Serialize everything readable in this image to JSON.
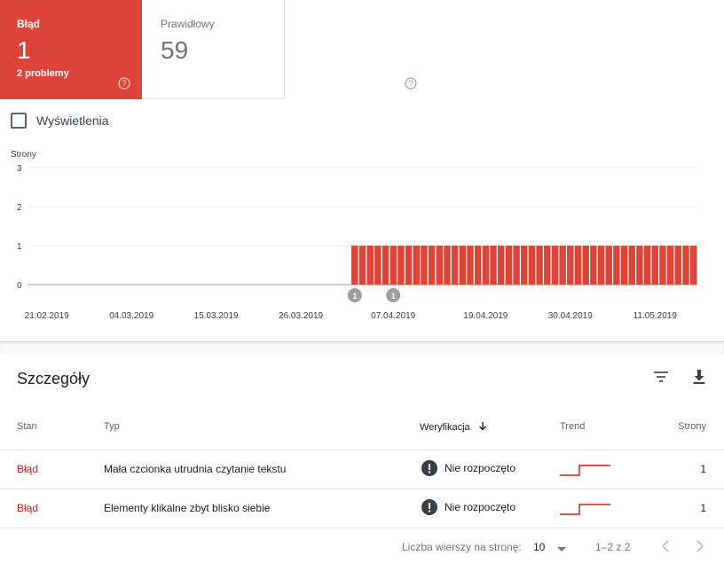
{
  "cards": {
    "error": {
      "label": "Błąd",
      "value": "1",
      "sub": "2 problemy",
      "color": "#db4437"
    },
    "valid": {
      "label": "Prawidłowy",
      "value": "59"
    }
  },
  "impressions_checkbox": {
    "label": "Wyświetlenia",
    "checked": false
  },
  "chart_data": {
    "type": "bar",
    "ylabel": "Strony",
    "y_ticks": [
      "3",
      "2",
      "1",
      "0"
    ],
    "ylim": [
      0,
      3
    ],
    "x_tick_labels": [
      "21.02.2019",
      "04.03.2019",
      "15.03.2019",
      "26.03.2019",
      "07.04.2019",
      "19.04.2019",
      "30.04.2019",
      "11.05.2019"
    ],
    "grid": true,
    "color": "#db4437",
    "x_range": [
      "2019-02-21",
      "2019-05-17"
    ],
    "series": [
      {
        "start": "2019-04-03",
        "end": "2019-05-17",
        "value": 1
      }
    ],
    "annotations": [
      {
        "date": "2019-04-03",
        "label": "1"
      }
    ],
    "annotations_2": [
      {
        "date": "2019-04-08",
        "label": "1"
      }
    ]
  },
  "details": {
    "title": "Szczegóły",
    "filter_icon": "filter-list-icon",
    "download_icon": "download-icon",
    "columns": {
      "status": "Stan",
      "type": "Typ",
      "verification": "Weryfikacja",
      "trend": "Trend",
      "pages": "Strony"
    },
    "rows": [
      {
        "status": "Błąd",
        "type": "Mała czcionka utrudnia czytanie tekstu",
        "verification": "Nie rozpoczęto",
        "pages": "1"
      },
      {
        "status": "Błąd",
        "type": "Elementy klikalne zbyt blisko siebie",
        "verification": "Nie rozpoczęto",
        "pages": "1"
      }
    ]
  },
  "pagination": {
    "rows_label": "Liczba wierszy na stronę:",
    "page_size": "10",
    "range": "1–2 z 2"
  }
}
